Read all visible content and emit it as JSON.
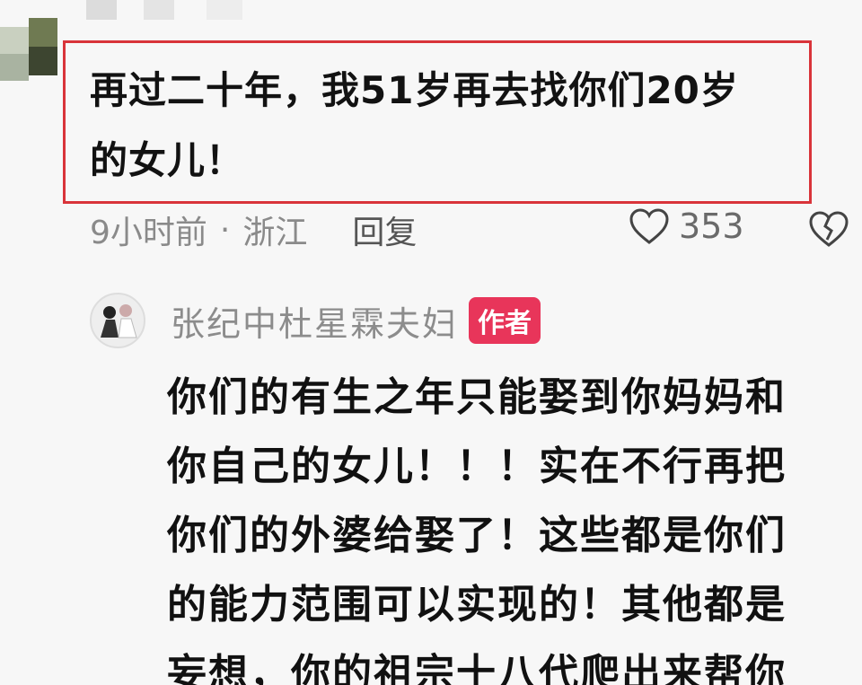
{
  "comment": {
    "line1": "再过二十年，我51岁再去找你们20岁",
    "line2": "的女儿！",
    "time": "9小时前",
    "separator": "·",
    "location": "浙江",
    "reply_label": "回复",
    "like_count": "353"
  },
  "reply": {
    "author_name": "张纪中杜星霖夫妇",
    "author_badge": "作者",
    "lines": [
      "你们的有生之年只能娶到你妈妈和",
      "你自己的女儿！！！实在不行再把",
      "你们的外婆给娶了！这些都是你们",
      "的能力范围可以实现的！其他都是",
      "妄想，你的祖宗十八代爬出来帮你"
    ]
  },
  "colors": {
    "highlight": "#d9343a",
    "badge": "#e8355a"
  },
  "icons": [
    "heart-icon",
    "broken-heart-icon"
  ]
}
